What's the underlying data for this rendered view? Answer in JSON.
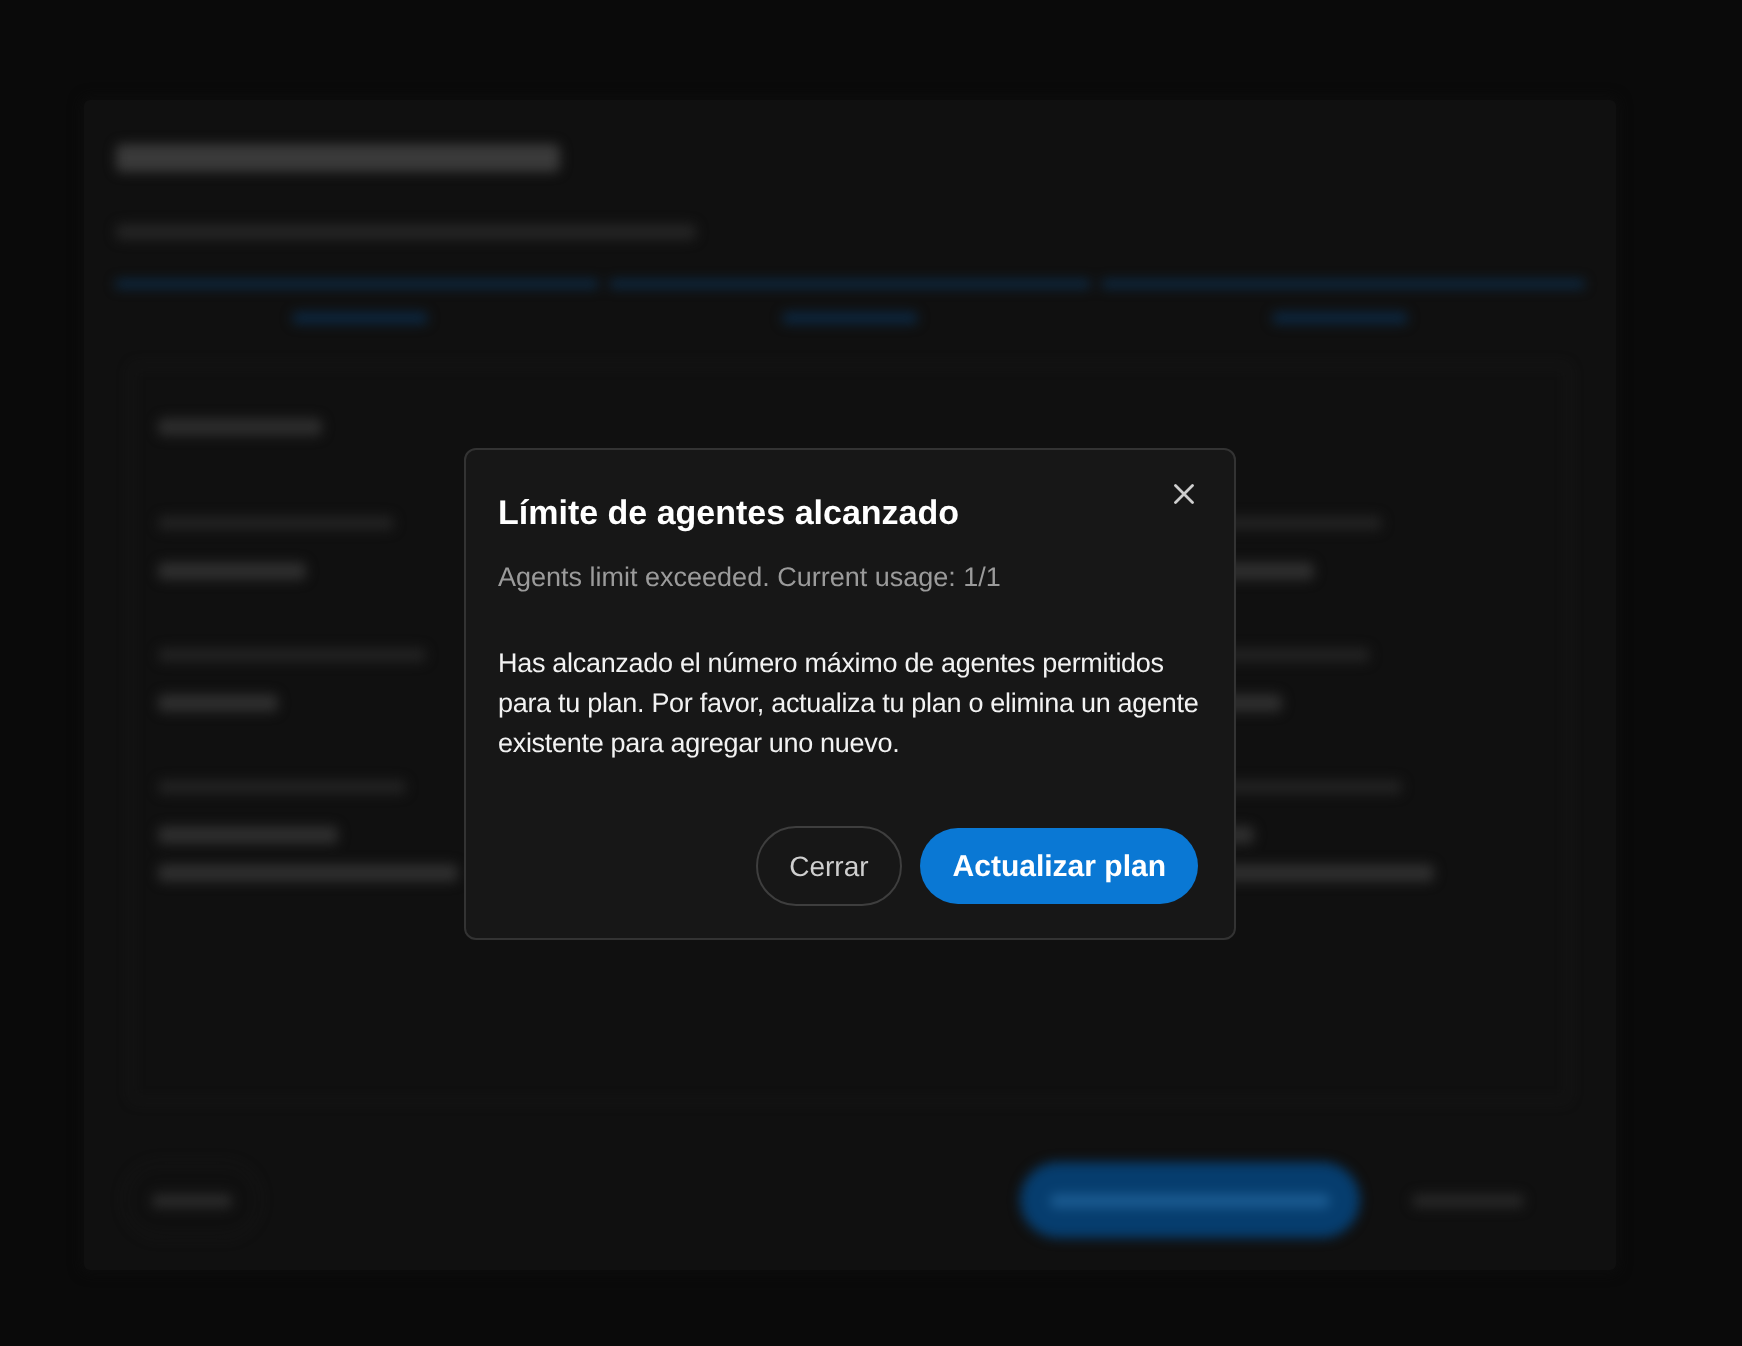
{
  "dialog": {
    "title": "Límite de agentes alcanzado",
    "subtitle": "Agents limit exceeded. Current usage: 1/1",
    "message": "Has alcanzado el número máximo de agentes permitidos para tu plan. Por favor, actualiza tu plan o elimina un agente existente para agregar uno nuevo.",
    "buttons": [
      {
        "label": "Cerrar",
        "kind": "secondary"
      },
      {
        "label": "Actualizar plan",
        "kind": "primary"
      }
    ]
  }
}
